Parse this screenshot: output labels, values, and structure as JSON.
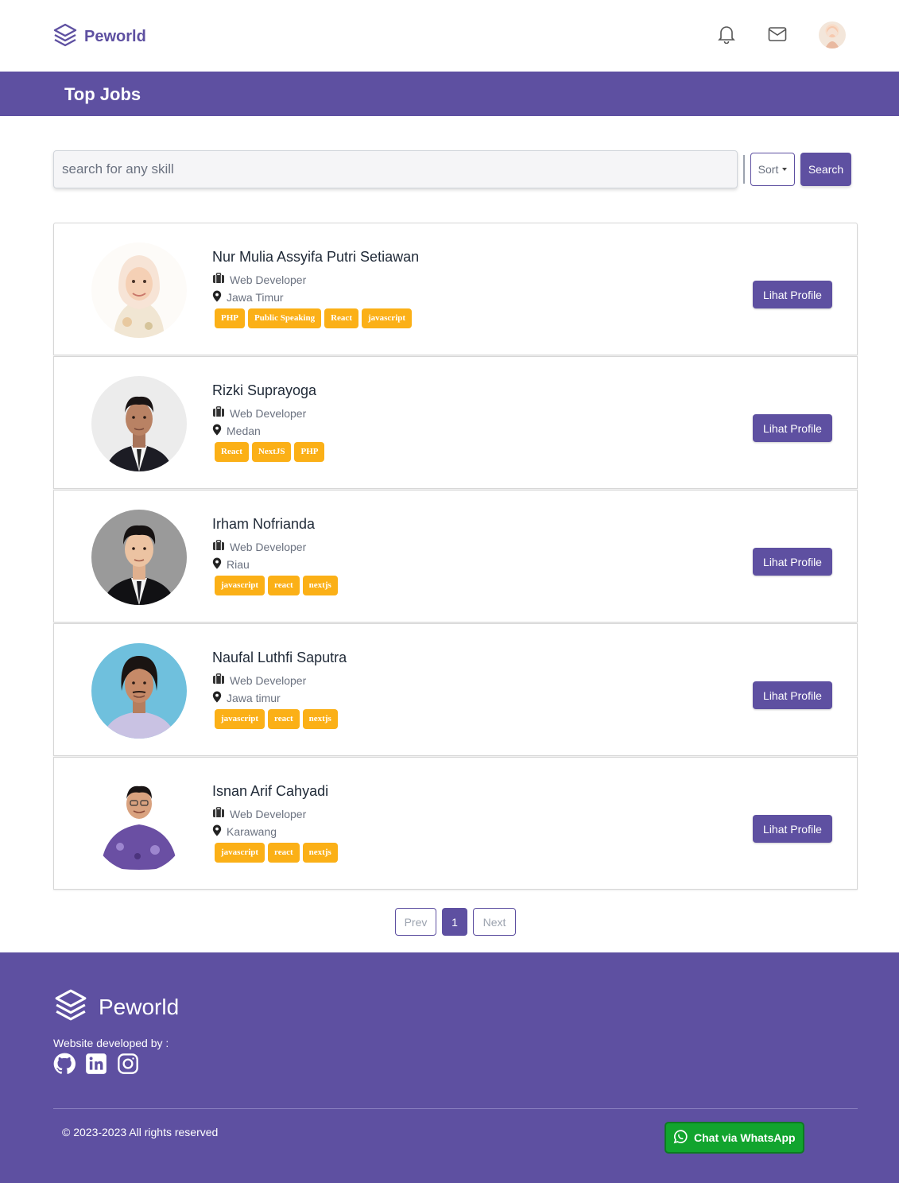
{
  "navbar": {
    "brand": "Peworld",
    "icons": [
      "bell-icon",
      "mail-icon"
    ],
    "accent": "#5e50a1"
  },
  "banner": {
    "title": "Top Jobs"
  },
  "search": {
    "placeholder": "search for any skill",
    "sort_label": "Sort",
    "button_label": "Search"
  },
  "candidates": [
    {
      "name": "Nur Mulia Assyifa Putri Setiawan",
      "job": "Web Developer",
      "location": "Jawa Timur",
      "skills": [
        "PHP",
        "Public Speaking",
        "React",
        "javascript"
      ],
      "button": "Lihat Profile"
    },
    {
      "name": "Rizki Suprayoga",
      "job": "Web Developer",
      "location": "Medan",
      "skills": [
        "React",
        "NextJS",
        "PHP"
      ],
      "button": "Lihat Profile"
    },
    {
      "name": "Irham Nofrianda",
      "job": "Web Developer",
      "location": "Riau",
      "skills": [
        "javascript",
        "react",
        "nextjs"
      ],
      "button": "Lihat Profile"
    },
    {
      "name": "Naufal Luthfi Saputra",
      "job": "Web Developer",
      "location": "Jawa timur",
      "skills": [
        "javascript",
        "react",
        "nextjs"
      ],
      "button": "Lihat Profile"
    },
    {
      "name": "Isnan Arif Cahyadi",
      "job": "Web Developer",
      "location": "Karawang",
      "skills": [
        "javascript",
        "react",
        "nextjs"
      ],
      "button": "Lihat Profile"
    }
  ],
  "pagination": {
    "prev": "Prev",
    "current": "1",
    "next": "Next"
  },
  "footer": {
    "brand": "Peworld",
    "developed_by": "Website developed by :",
    "social_icons": [
      "github-icon",
      "linkedin-icon",
      "instagram-icon"
    ],
    "copyright": "© 2023-2023 All rights reserved",
    "whatsapp_label": "Chat via WhatsApp"
  },
  "colors": {
    "primary": "#5e50a1",
    "skill_badge": "#fbb017",
    "whatsapp": "#12a42e"
  }
}
